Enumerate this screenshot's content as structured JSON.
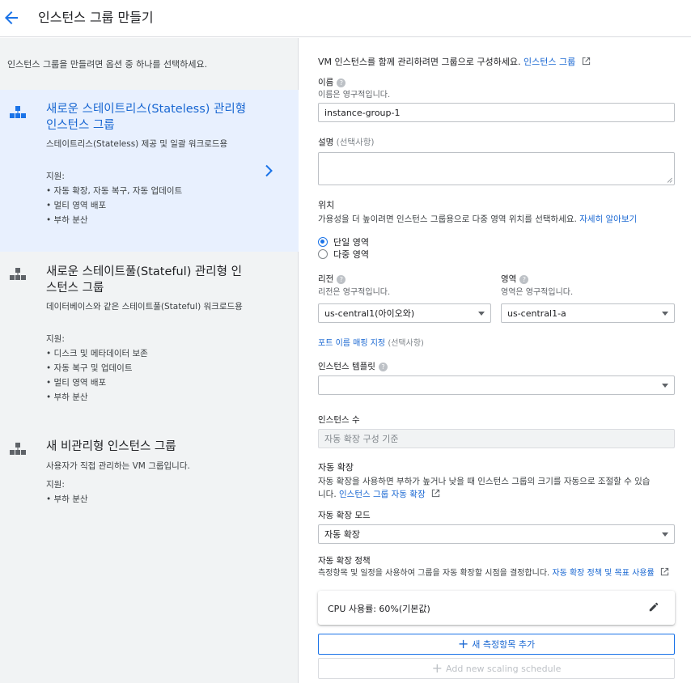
{
  "header": {
    "title": "인스턴스 그룹 만들기"
  },
  "left": {
    "intro": "인스턴스 그룹을 만들려면 옵션 중 하나를 선택하세요.",
    "options": [
      {
        "title": "새로운 스테이트리스(Stateless) 관리형 인스턴스 그룹",
        "desc": "스테이트리스(Stateless) 제공 및 일괄 워크로드용",
        "support_label": "지원:",
        "features": [
          "• 자동 확장, 자동 복구, 자동 업데이트",
          "• 멀티 영역 배포",
          "• 부하 분산"
        ]
      },
      {
        "title": "새로운 스테이트풀(Stateful) 관리형 인스턴스 그룹",
        "desc": "데이터베이스와 같은 스테이트풀(Stateful) 워크로드용",
        "support_label": "지원:",
        "features": [
          "• 디스크 및 메타데이터 보존",
          "• 자동 복구 및 업데이트",
          "• 멀티 영역 배포",
          "• 부하 분산"
        ]
      },
      {
        "title": "새 비관리형 인스턴스 그룹",
        "desc": "사용자가 직접 관리하는 VM 그룹입니다.",
        "support_label": "지원:",
        "features": [
          "• 부하 분산"
        ]
      }
    ]
  },
  "form": {
    "intro": "VM 인스턴스를 함께 관리하려면 그룹으로 구성하세요.",
    "intro_link": "인스턴스 그룹",
    "name": {
      "label": "이름",
      "hint": "이름은 영구적입니다.",
      "value": "instance-group-1"
    },
    "description": {
      "label": "설명",
      "optional": "(선택사항)",
      "value": ""
    },
    "location": {
      "label": "위치",
      "desc": "가용성을 더 높이려면 인스턴스 그룹용으로 다중 영역 위치를 선택하세요.",
      "learn_more": "자세히 알아보기",
      "single": "단일 영역",
      "multi": "다중 영역"
    },
    "region": {
      "label": "리전",
      "hint": "리전은 영구적입니다.",
      "value": "us-central1(아이오와)"
    },
    "zone": {
      "label": "영역",
      "hint": "영역은 영구적입니다.",
      "value": "us-central1-a"
    },
    "port_mapping": {
      "link": "포트 이름 매핑 지정",
      "optional": "(선택사항)"
    },
    "template": {
      "label": "인스턴스 템플릿",
      "value": ""
    },
    "instance_count": {
      "label": "인스턴스 수",
      "placeholder": "자동 확장 구성 기준"
    },
    "autoscaling": {
      "label": "자동 확장",
      "desc_line1": "자동 확장을 사용하면 부하가 높거나 낮을 때 인스턴스 그룹의 크기를 자동으로 조절할 수 있습",
      "desc_line2": "니다.",
      "link": "인스턴스 그룹 자동 확장"
    },
    "autoscale_mode": {
      "label": "자동 확장 모드",
      "value": "자동 확장"
    },
    "policy": {
      "label": "자동 확장 정책",
      "desc": "측정항목 및 일정을 사용하여 그룹을 자동 확장할 시점을 결정합니다.",
      "link": "자동 확장 정책 및 목표 사용률",
      "metric": "CPU 사용률: 60%(기본값)"
    },
    "add_metric": "새 측정항목 추가",
    "add_schedule": "Add new scaling schedule"
  },
  "colors": {
    "accent": "#1a73e8",
    "link": "#1967d2",
    "selected_bg": "#e8f0fe",
    "panel_bg": "#f1f3f4"
  }
}
